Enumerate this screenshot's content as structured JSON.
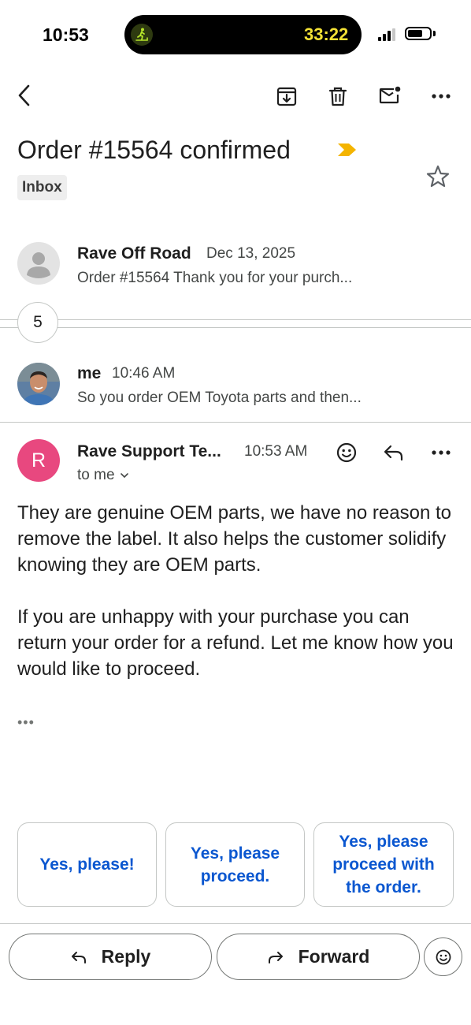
{
  "status_bar": {
    "time": "10:53",
    "activity_icon": "treadmill-icon",
    "timer": "33:22",
    "signal_icon": "cellular-signal-icon",
    "battery_icon": "battery-icon"
  },
  "toolbar": {
    "back_icon": "back-arrow-icon",
    "archive_icon": "archive-icon",
    "delete_icon": "trash-icon",
    "mark_unread_icon": "mail-unread-icon",
    "more_icon": "more-horizontal-icon"
  },
  "thread": {
    "subject": "Order #15564 confirmed",
    "importance_icon": "importance-marker-icon",
    "label": "Inbox",
    "star_icon": "star-outline-icon",
    "collapsed_count": "5"
  },
  "messages": [
    {
      "sender": "Rave Off Road",
      "date": "Dec 13, 2025",
      "snippet": "Order #15564 Thank you for your purch..."
    },
    {
      "sender": "me",
      "date": "10:46 AM",
      "snippet": "So you order OEM Toyota parts and then..."
    },
    {
      "sender": "Rave Support Te...",
      "avatar_letter": "R",
      "date": "10:53 AM",
      "recipient": "to me",
      "paragraphs": [
        "They are genuine OEM parts, we have no reason to remove the label. It also helps the customer solidify knowing they are OEM parts.",
        "If you are unhappy with your purchase you can return your order for a refund. Let me know how you would like to proceed."
      ],
      "trimmed_content": "•••"
    }
  ],
  "smart_replies": [
    "Yes, please!",
    "Yes, please proceed.",
    "Yes, please proceed with the order."
  ],
  "actions": {
    "reply": "Reply",
    "forward": "Forward",
    "emoji_icon": "emoji-icon"
  },
  "colors": {
    "accent": "#0b57d0",
    "avatar_pink": "#e8487f",
    "timer_yellow": "#f3e135",
    "importance_yellow": "#f4b400"
  }
}
